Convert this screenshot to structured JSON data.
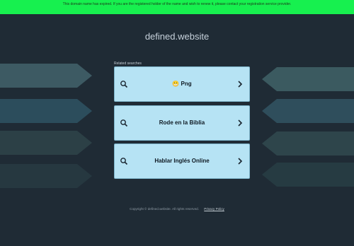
{
  "banner": {
    "text": "This domain name has expired. If you are the registered holder of the name and wish to renew it, please contact your registration service provider."
  },
  "header": {
    "domain": "defined.website"
  },
  "related": {
    "label": "Related searches",
    "items": [
      {
        "label": "😬 Png"
      },
      {
        "label": "Rode en la Biblia"
      },
      {
        "label": "Hablar Inglés Online"
      }
    ]
  },
  "footer": {
    "copyright": "Copyright © defined.website.  All rights reserved.",
    "privacy": "Privacy Policy"
  },
  "colors": {
    "banner_bg": "#17f04f",
    "page_bg": "#1f2b35",
    "card_bg": "#b6e3f4"
  }
}
